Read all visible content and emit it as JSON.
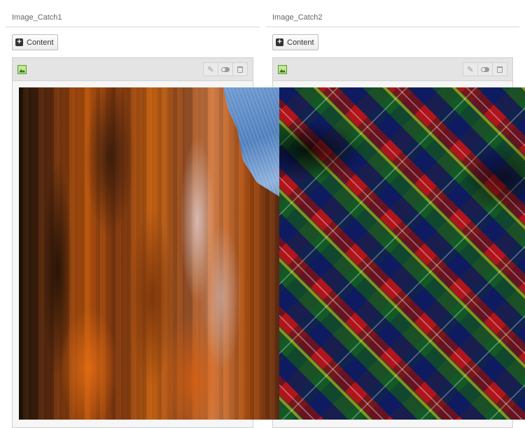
{
  "columns": [
    {
      "title": "Image_Catch1",
      "content_button_label": "Content",
      "element": {
        "type_icon": "image-icon",
        "actions": [
          "pencil-icon",
          "toggle-icon",
          "trash-icon"
        ],
        "image": "rust-texture-photo"
      }
    },
    {
      "title": "Image_Catch2",
      "content_button_label": "Content",
      "element": {
        "type_icon": "image-icon",
        "actions": [
          "pencil-icon",
          "toggle-icon",
          "trash-icon"
        ],
        "image": "tartan-fabric-photo"
      }
    }
  ],
  "icons": {
    "pencil": "✎",
    "plus": "+"
  },
  "colors": {
    "header_bg": "#e4e4e4",
    "panel_border": "#d0d0d0",
    "button_bg": "#ececec"
  }
}
